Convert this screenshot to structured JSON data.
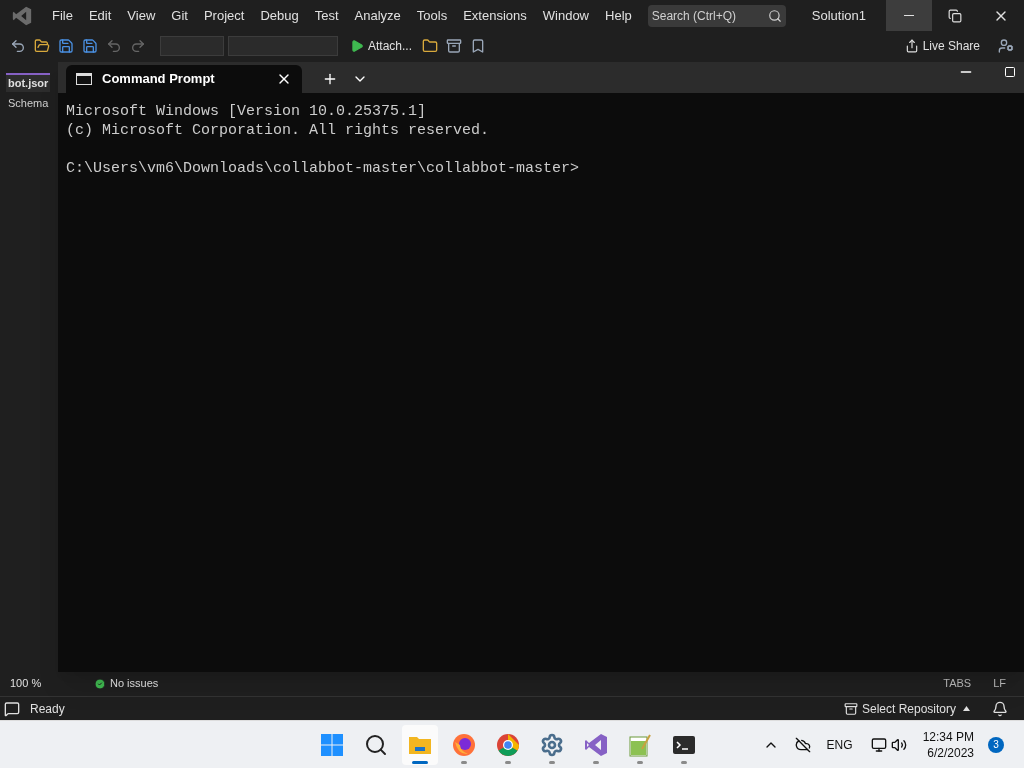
{
  "ide": {
    "menu": [
      "File",
      "Edit",
      "View",
      "Git",
      "Project",
      "Debug",
      "Test",
      "Analyze",
      "Tools",
      "Extensions",
      "Window",
      "Help"
    ],
    "search": {
      "placeholder": "Search (Ctrl+Q)"
    },
    "solution": "Solution1",
    "toolbar": {
      "attach": "Attach...",
      "live_share": "Live Share"
    },
    "editor_tab": "bot.jsor",
    "editor_subtab": "Schema",
    "zoom": "100 %",
    "issues": "No issues",
    "status_items": [
      "TABS",
      "LF"
    ],
    "status": "Ready",
    "repository": "Select Repository"
  },
  "terminal": {
    "tabs": [
      {
        "title": "Command Prompt",
        "selected": true
      }
    ],
    "header": [
      "Microsoft Windows [Version 10.0.25375.1]",
      "(c) Microsoft Corporation. All rights reserved."
    ],
    "prompt": "C:\\Users\\vm6\\Downloads\\collabbot-master\\collabbot-master>"
  },
  "taskbar": {
    "apps": [
      {
        "kind": "start",
        "running": false,
        "selected": false
      },
      {
        "kind": "search",
        "running": false,
        "selected": false
      },
      {
        "kind": "explorer",
        "running": true,
        "selected": true
      },
      {
        "kind": "firefox",
        "running": true,
        "selected": false
      },
      {
        "kind": "chrome",
        "running": true,
        "selected": false
      },
      {
        "kind": "settings",
        "running": true,
        "selected": false
      },
      {
        "kind": "studio",
        "running": true,
        "selected": false
      },
      {
        "kind": "notepad",
        "running": true,
        "selected": false
      },
      {
        "kind": "terminal",
        "running": true,
        "selected": false
      }
    ],
    "language": "ENG",
    "time": "12:34 PM",
    "date": "6/2/2023",
    "notifications": "3"
  }
}
